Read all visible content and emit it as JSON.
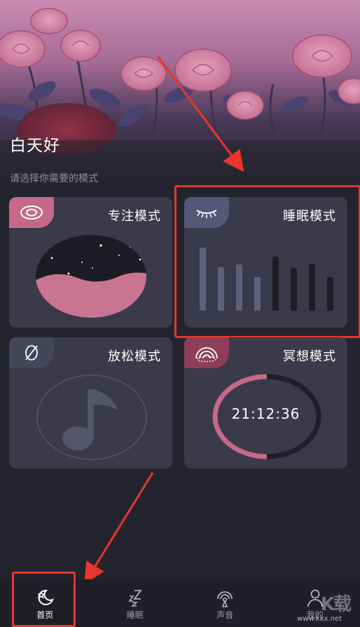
{
  "header": {
    "greeting": "白天好",
    "subtitle": "请选择你需要的模式"
  },
  "cards": [
    {
      "title": "专注模式",
      "icon": "eye-icon"
    },
    {
      "title": "睡眠模式",
      "icon": "closed-eye-icon"
    },
    {
      "title": "放松模式",
      "icon": "leaf-icon"
    },
    {
      "title": "冥想模式",
      "icon": "rainbow-icon",
      "timer": "21:12:36"
    }
  ],
  "nav": [
    {
      "label": "首页",
      "icon": "moon-star-icon",
      "active": true
    },
    {
      "label": "睡眠",
      "icon": "zzz-icon"
    },
    {
      "label": "声音",
      "icon": "broadcast-icon"
    },
    {
      "label": "我的",
      "icon": "person-icon"
    }
  ],
  "sleep_bar_levels": [
    0.9,
    0.62,
    0.66,
    0.48,
    0.77,
    0.61,
    0.67,
    0.48
  ],
  "watermark": {
    "logo": "K载",
    "url": "www.kkx.net"
  },
  "colors": {
    "accent_pink": "#c46a88",
    "highlight_red": "#e8362c",
    "background": "#24242e",
    "card": "#3a3a4a"
  }
}
